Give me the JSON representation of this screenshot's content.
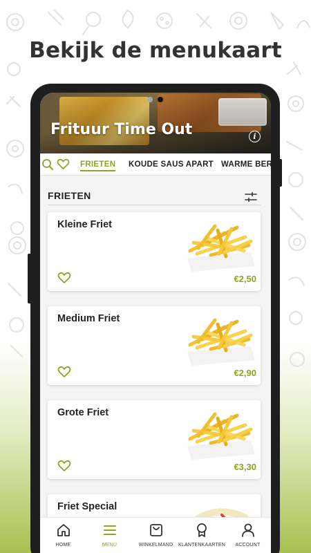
{
  "headline": "Bekijk de menukaart",
  "restaurant": {
    "name": "Frituur Time Out"
  },
  "tabs": [
    {
      "label": "FRIETEN",
      "active": true
    },
    {
      "label": "KOUDE SAUS APART",
      "active": false
    },
    {
      "label": "WARME BERI",
      "active": false
    }
  ],
  "section": {
    "title": "FRIETEN"
  },
  "products": [
    {
      "name": "Kleine Friet",
      "price": "€2,50"
    },
    {
      "name": "Medium Friet",
      "price": "€2,90"
    },
    {
      "name": "Grote Friet",
      "price": "€3,30"
    },
    {
      "name": "Friet Special",
      "price": ""
    }
  ],
  "nav": [
    {
      "label": "HOME",
      "icon": "home-icon",
      "active": false
    },
    {
      "label": "MENU",
      "icon": "menu-icon",
      "active": true
    },
    {
      "label": "WINKELMAND",
      "icon": "shopping-bag-icon",
      "active": false
    },
    {
      "label": "KLANTENKAARTEN",
      "icon": "loyalty-badge-icon",
      "active": false
    },
    {
      "label": "ACCOUNT",
      "icon": "account-icon",
      "active": false
    }
  ],
  "colors": {
    "accent": "#8aa61e",
    "background_bottom": "#a9c04f",
    "text": "#222222"
  }
}
